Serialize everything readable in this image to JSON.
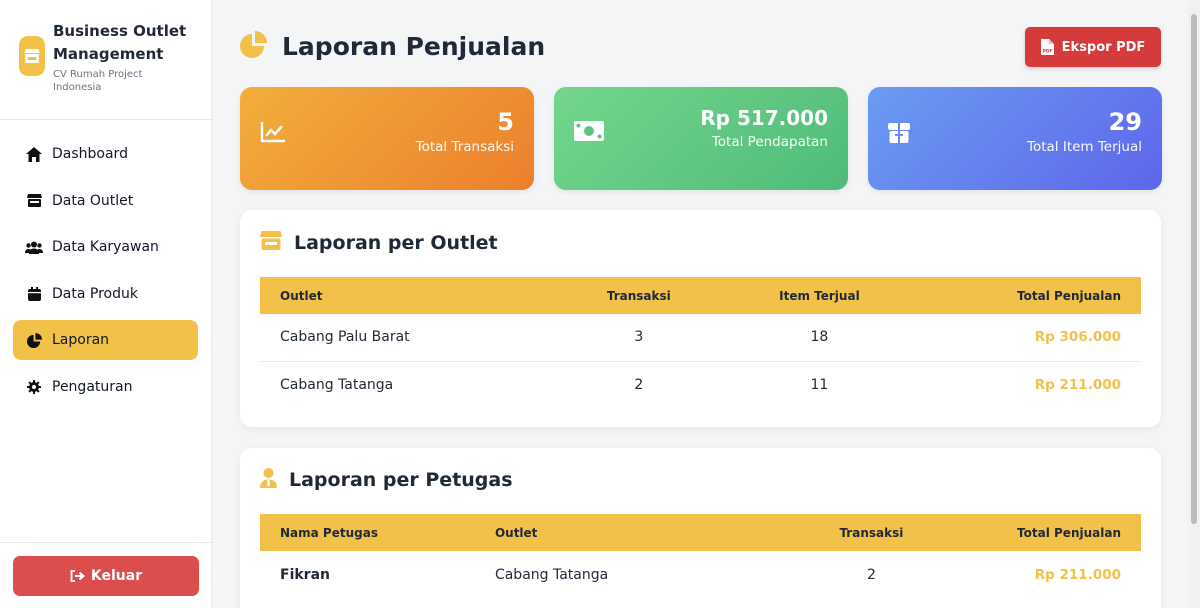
{
  "brand": {
    "title": "Business Outlet Management",
    "subtitle": "CV Rumah Project Indonesia"
  },
  "sidebar": {
    "items": [
      {
        "label": "Dashboard",
        "icon": "home-icon"
      },
      {
        "label": "Data Outlet",
        "icon": "store-icon"
      },
      {
        "label": "Data Karyawan",
        "icon": "users-icon"
      },
      {
        "label": "Data Produk",
        "icon": "box-icon"
      },
      {
        "label": "Laporan",
        "icon": "pie-chart-icon",
        "active": true
      },
      {
        "label": "Pengaturan",
        "icon": "gear-icon"
      }
    ],
    "logout_label": "Keluar"
  },
  "page": {
    "title": "Laporan Penjualan",
    "export_label": "Ekspor PDF"
  },
  "stats": [
    {
      "value": "5",
      "label": "Total Transaksi",
      "icon": "line-chart-icon"
    },
    {
      "value": "Rp 517.000",
      "label": "Total Pendapatan",
      "icon": "money-icon"
    },
    {
      "value": "29",
      "label": "Total Item Terjual",
      "icon": "gift-box-icon"
    }
  ],
  "outlet_report": {
    "title": "Laporan per Outlet",
    "headers": [
      "Outlet",
      "Transaksi",
      "Item Terjual",
      "Total Penjualan"
    ],
    "rows": [
      [
        "Cabang Palu Barat",
        "3",
        "18",
        "Rp 306.000"
      ],
      [
        "Cabang Tatanga",
        "2",
        "11",
        "Rp 211.000"
      ]
    ]
  },
  "staff_report": {
    "title": "Laporan per Petugas",
    "headers": [
      "Nama Petugas",
      "Outlet",
      "Transaksi",
      "Total Penjualan"
    ],
    "rows": [
      [
        "Fikran",
        "Cabang Tatanga",
        "2",
        "Rp 211.000"
      ]
    ]
  },
  "colors": {
    "accent": "#f2c14a",
    "danger": "#dc4d4d",
    "card_orange": "#ec7f2d",
    "card_green": "#4fbb7a",
    "card_blue": "#5e66ea"
  }
}
